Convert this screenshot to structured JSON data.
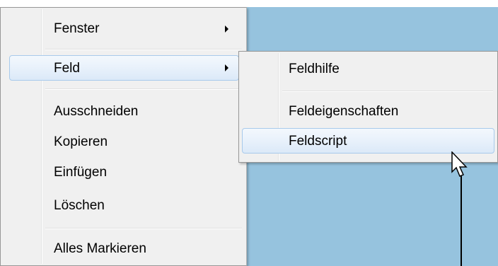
{
  "menu": {
    "items": [
      {
        "label": "Fenster",
        "submenu": true
      },
      {
        "label": "Feld",
        "submenu": true,
        "highlighted": true
      },
      {
        "label": "Ausschneiden"
      },
      {
        "label": "Kopieren"
      },
      {
        "label": "Einfügen"
      },
      {
        "label": "Löschen"
      },
      {
        "label": "Alles Markieren"
      }
    ]
  },
  "submenu": {
    "items": [
      {
        "label": "Feldhilfe"
      },
      {
        "label": "Feldeigenschaften"
      },
      {
        "label": "Feldscript",
        "highlighted": true
      }
    ]
  },
  "colors": {
    "background": "#96c3de",
    "menu": "#f0f0f0",
    "highlight_border": "#a8caeb"
  },
  "icons": [
    "arrow-right-icon",
    "mouse-pointer-icon"
  ]
}
